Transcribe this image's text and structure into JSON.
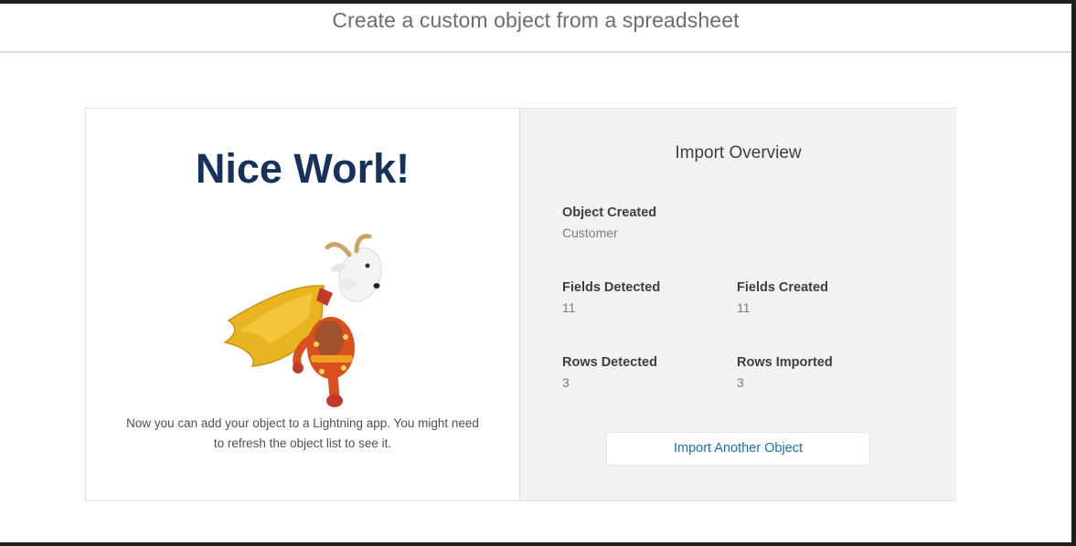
{
  "header": {
    "title": "Create a custom object from a spreadsheet"
  },
  "success": {
    "heading": "Nice Work!",
    "mascot_icon": "superhero-goat-mascot",
    "message": "Now you can add your object to a Lightning app. You might need to refresh the object list to see it."
  },
  "overview": {
    "title": "Import Overview",
    "object_created_label": "Object Created",
    "object_created_value": "Customer",
    "fields_detected_label": "Fields Detected",
    "fields_detected_value": "11",
    "fields_created_label": "Fields Created",
    "fields_created_value": "11",
    "rows_detected_label": "Rows Detected",
    "rows_detected_value": "3",
    "rows_imported_label": "Rows Imported",
    "rows_imported_value": "3",
    "import_another_label": "Import Another Object"
  },
  "colors": {
    "heading": "#16325c",
    "link": "#1b6fb5",
    "panel_bg": "#f3f2f2"
  }
}
